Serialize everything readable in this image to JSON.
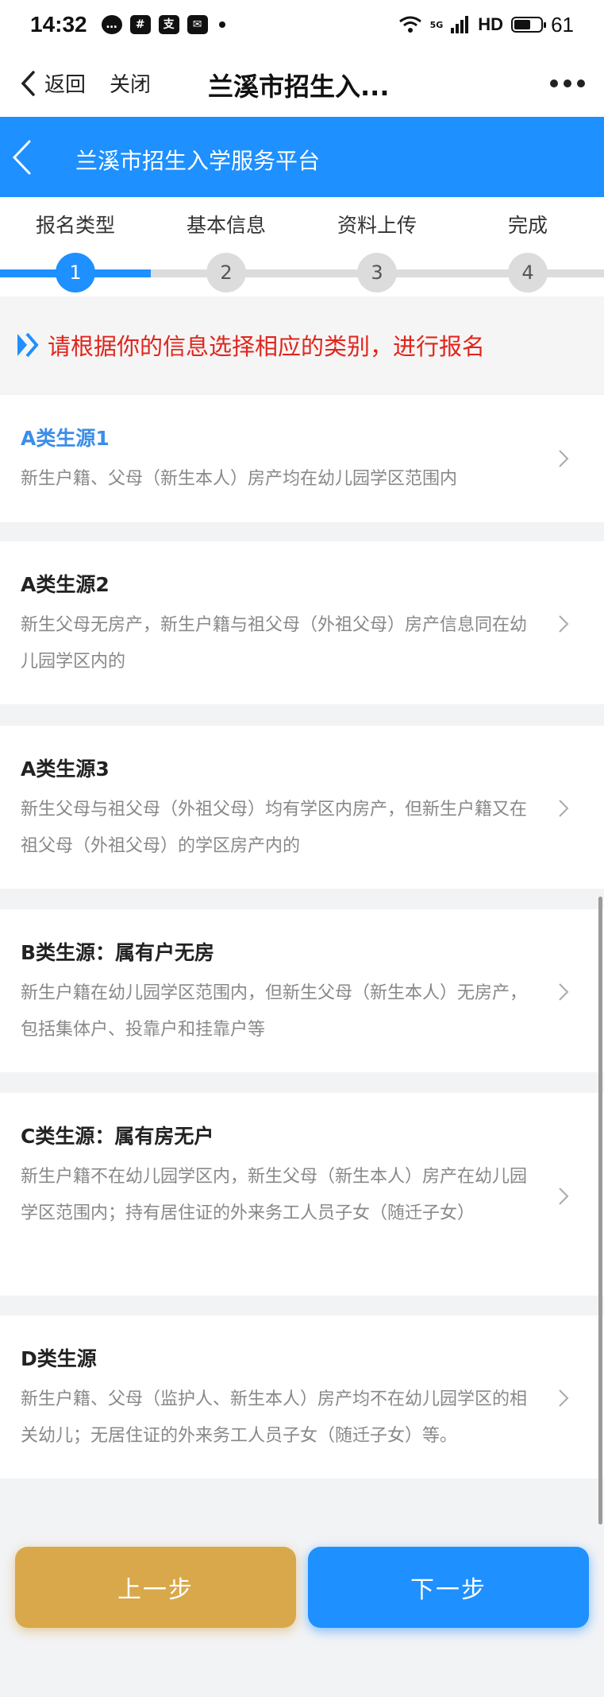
{
  "status_bar": {
    "time": "14:32",
    "icons": [
      "message-icon",
      "hash-icon",
      "alipay-icon",
      "mail-icon"
    ],
    "network": "5G",
    "hd": "HD",
    "battery_percent": 61,
    "battery_text": "61"
  },
  "nav": {
    "back_label": "返回",
    "close_label": "关闭",
    "title": "兰溪市招生入..."
  },
  "header": {
    "title": "兰溪市招生入学服务平台"
  },
  "steps": [
    {
      "label": "报名类型",
      "num": "1"
    },
    {
      "label": "基本信息",
      "num": "2"
    },
    {
      "label": "资料上传",
      "num": "3"
    },
    {
      "label": "完成",
      "num": "4"
    }
  ],
  "hint": "请根据你的信息选择相应的类别，进行报名",
  "categories": [
    {
      "title": "A类生源1",
      "desc": "新生户籍、父母（新生本人）房产均在幼儿园学区范围内"
    },
    {
      "title": "A类生源2",
      "desc": "新生父母无房产，新生户籍与祖父母（外祖父母）房产信息同在幼儿园学区内的"
    },
    {
      "title": "A类生源3",
      "desc": "新生父母与祖父母（外祖父母）均有学区内房产，但新生户籍又在祖父母（外祖父母）的学区房产内的"
    },
    {
      "title": "B类生源：属有户无房",
      "desc": "新生户籍在幼儿园学区范围内，但新生父母（新生本人）无房产，包括集体户、投靠户和挂靠户等"
    },
    {
      "title": "C类生源：属有房无户",
      "desc": "新生户籍不在幼儿园学区内，新生父母（新生本人）房产在幼儿园学区范围内；持有居住证的外来务工人员子女（随迁子女）"
    },
    {
      "title": "D类生源",
      "desc": "新生户籍、父母（监护人、新生本人）房产均不在幼儿园学区的相关幼儿；无居住证的外来务工人员子女（随迁子女）等。"
    }
  ],
  "buttons": {
    "prev_label": "上一步",
    "next_label": "下一步"
  },
  "colors": {
    "primary": "#1e90ff",
    "hint_red": "#e0251c",
    "prev_button": "#d8a84a",
    "active_title": "#3b8ee8"
  }
}
